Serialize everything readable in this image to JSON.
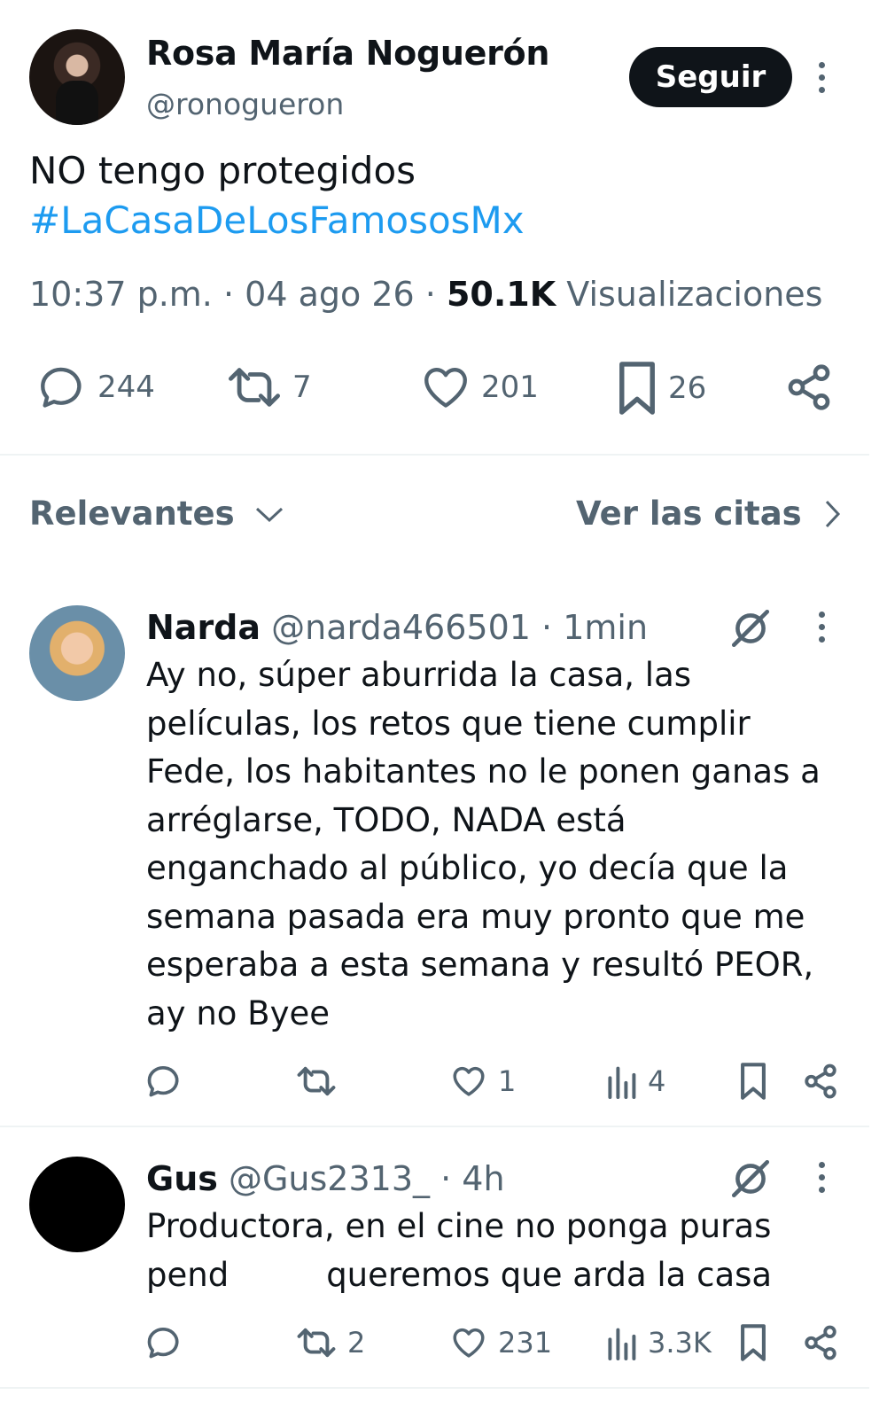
{
  "main_tweet": {
    "author_name": "Rosa María Noguerón",
    "author_handle": "@ronogueron",
    "follow_label": "Seguir",
    "text_line1": "NO tengo protegidos",
    "hashtag": "#LaCasaDeLosFamososMx",
    "time": "10:37 p.m.",
    "date": "04 ago 26",
    "views_count": "50.1K",
    "views_label": "Visualizaciones",
    "separator": "·",
    "stats": {
      "replies": "244",
      "retweets": "7",
      "likes": "201",
      "bookmarks": "26"
    }
  },
  "sort_bar": {
    "sort_label": "Relevantes",
    "quotes_label": "Ver las citas"
  },
  "replies": [
    {
      "name": "Narda",
      "handle": "@narda466501",
      "time": "1min",
      "lines": [
        "Ay no, súper aburrida la casa, las",
        "películas, los retos que tiene cumplir",
        "Fede, los habitantes no le ponen ganas a",
        "arréglarse, TODO, NADA está",
        "enganchado al público, yo decía que la",
        "semana pasada era muy pronto que me",
        "esperaba a esta semana y resultó PEOR,",
        "ay no Byee"
      ],
      "likes": "1",
      "views": "4",
      "retweets": ""
    },
    {
      "name": "Gus",
      "handle": "@Gus2313_",
      "time": "4h",
      "line1": "Productora, en el cine no ponga puras",
      "line2_start": "pend",
      "line2_end": "queremos que arda la casa",
      "retweets": "2",
      "likes": "231",
      "views": "3.3K"
    }
  ],
  "colors": {
    "text": "#0f1419",
    "secondary": "#536471",
    "link": "#1d9bf0",
    "divider": "#eff3f4"
  }
}
